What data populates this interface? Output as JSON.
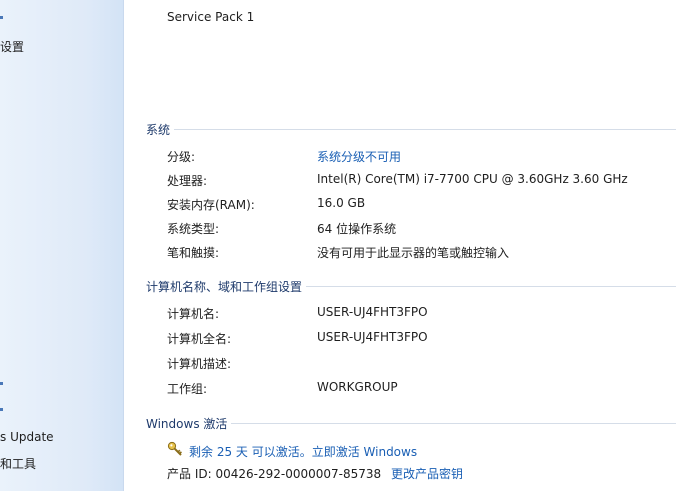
{
  "sidebar": {
    "items": [
      {
        "label": "设置"
      },
      {
        "label": "s Update"
      },
      {
        "label": "和工具"
      }
    ]
  },
  "edition": {
    "service_pack": "Service Pack 1"
  },
  "system": {
    "title": "系统",
    "rows": [
      {
        "label": "分级:",
        "value": "系统分级不可用",
        "is_link": true
      },
      {
        "label": "处理器:",
        "value": "Intel(R) Core(TM) i7-7700 CPU @ 3.60GHz   3.60 GHz"
      },
      {
        "label": "安装内存(RAM):",
        "value": "16.0 GB"
      },
      {
        "label": "系统类型:",
        "value": "64 位操作系统"
      },
      {
        "label": "笔和触摸:",
        "value": "没有可用于此显示器的笔或触控输入"
      }
    ]
  },
  "computer": {
    "title": "计算机名称、域和工作组设置",
    "rows": [
      {
        "label": "计算机名:",
        "value": "USER-UJ4FHT3FPO"
      },
      {
        "label": "计算机全名:",
        "value": "USER-UJ4FHT3FPO"
      },
      {
        "label": "计算机描述:",
        "value": ""
      },
      {
        "label": "工作组:",
        "value": "WORKGROUP"
      }
    ]
  },
  "activation": {
    "title": "Windows 激活",
    "link_text": "剩余 25 天 可以激活。立即激活 Windows",
    "product_id": "产品 ID: 00426-292-0000007-85738",
    "change_key": "更改产品密钥",
    "icon": "key-icon"
  },
  "colors": {
    "link": "#1a5fb4",
    "sidebar_bg": "#dfeaf8",
    "section_title": "#1e3a6b"
  }
}
